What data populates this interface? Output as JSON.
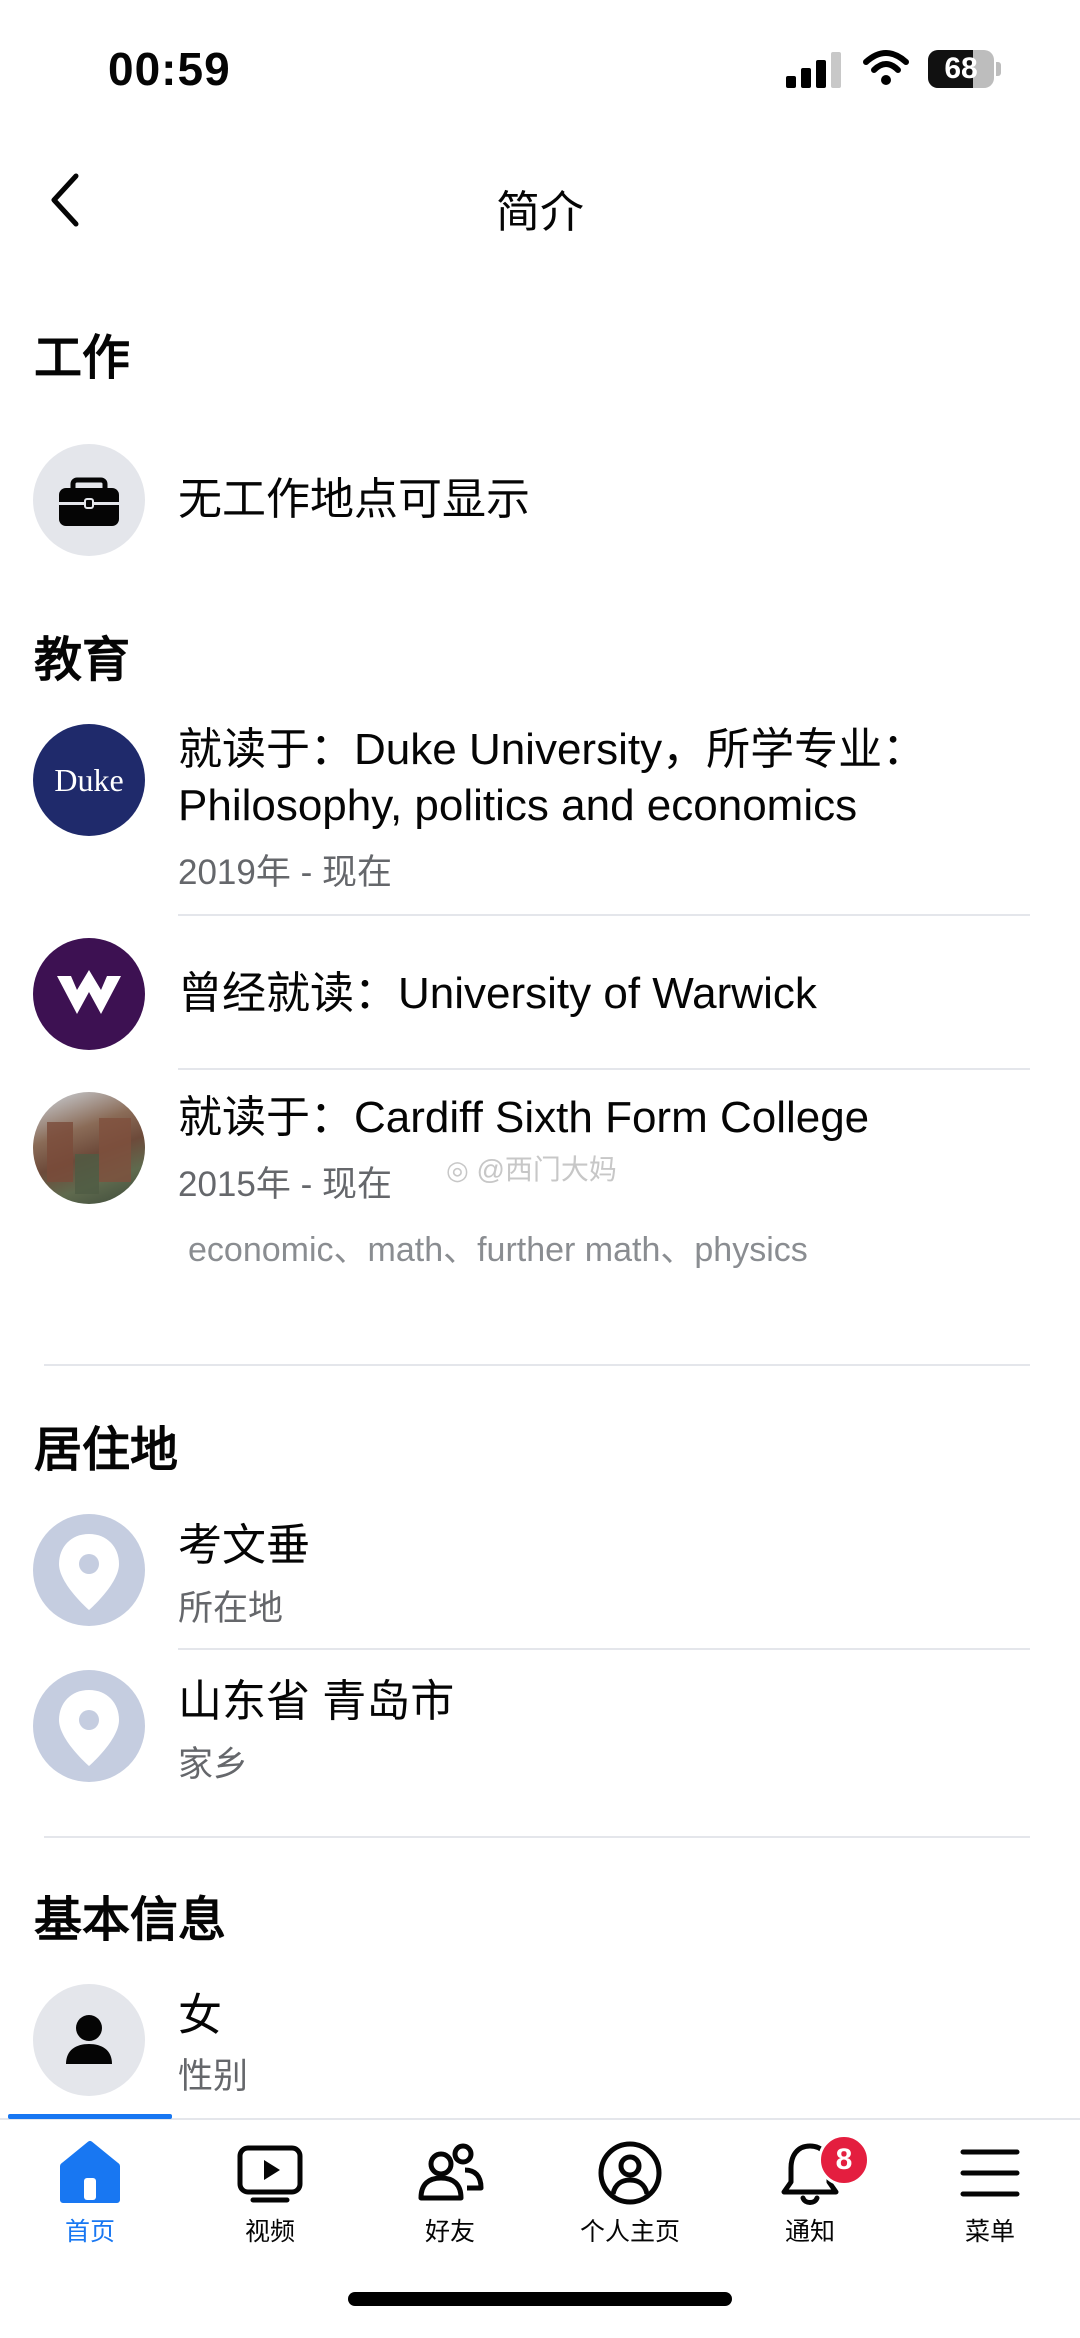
{
  "status_bar": {
    "time": "00:59",
    "battery": "68",
    "battery_level": 0.68
  },
  "header": {
    "title": "简介",
    "back_icon": "chevron-left-icon"
  },
  "work": {
    "heading": "工作",
    "items": [
      {
        "icon": "briefcase-icon",
        "text": "无工作地点可显示"
      }
    ]
  },
  "education": {
    "heading": "教育",
    "items": [
      {
        "logo_text": "Duke",
        "line1": "就读于：Duke University，所学专业：",
        "line2": "Philosophy, politics and economics",
        "sub": "2019年 - 现在"
      },
      {
        "logo_text": "W",
        "line1": "曾经就读：University of Warwick"
      },
      {
        "line1": "就读于：Cardiff Sixth Form College",
        "sub": "2015年 - 现在",
        "tags": "economic、math、further math、physics"
      }
    ],
    "watermark": "@西门大妈"
  },
  "residence": {
    "heading": "居住地",
    "items": [
      {
        "icon": "location-pin-icon",
        "title": "考文垂",
        "sub": "所在地"
      },
      {
        "icon": "location-pin-icon",
        "title": "山东省 青岛市",
        "sub": "家乡"
      }
    ]
  },
  "basic_info": {
    "heading": "基本信息",
    "items": [
      {
        "icon": "person-icon",
        "title": "女",
        "sub": "性别"
      }
    ]
  },
  "bottom_nav": {
    "items": [
      {
        "label": "首页",
        "icon": "home-icon",
        "active": true
      },
      {
        "label": "视频",
        "icon": "video-icon"
      },
      {
        "label": "好友",
        "icon": "friends-icon"
      },
      {
        "label": "个人主页",
        "icon": "profile-icon"
      },
      {
        "label": "通知",
        "icon": "bell-icon",
        "badge": "8"
      },
      {
        "label": "菜单",
        "icon": "menu-icon"
      }
    ]
  },
  "colors": {
    "accent": "#1877f2",
    "badge": "#e41e3f",
    "duke_blue": "#1f2a6b",
    "warwick_purple": "#3d1152"
  }
}
